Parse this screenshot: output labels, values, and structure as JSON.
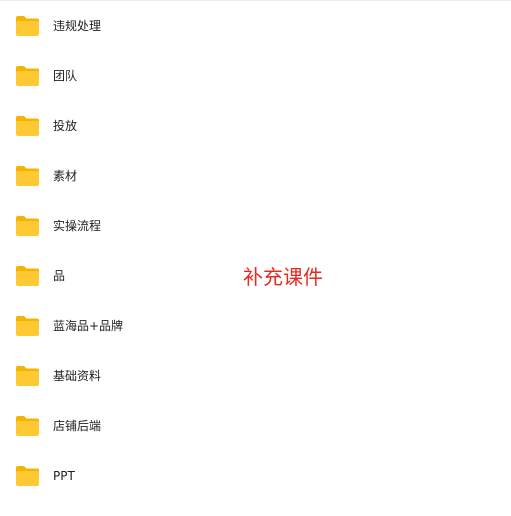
{
  "colors": {
    "folder_body": "#FFC933",
    "folder_back": "#F5B400",
    "annotation": "#E52B21"
  },
  "folders": [
    {
      "label": "违规处理",
      "icon": "folder-icon"
    },
    {
      "label": "团队",
      "icon": "folder-icon"
    },
    {
      "label": "投放",
      "icon": "folder-icon"
    },
    {
      "label": "素材",
      "icon": "folder-icon"
    },
    {
      "label": "实操流程",
      "icon": "folder-icon"
    },
    {
      "label": "品",
      "icon": "folder-icon"
    },
    {
      "label": "蓝海品+品牌",
      "icon": "folder-icon"
    },
    {
      "label": "基础资料",
      "icon": "folder-icon"
    },
    {
      "label": "店铺后端",
      "icon": "folder-icon"
    },
    {
      "label": "PPT",
      "icon": "folder-icon"
    }
  ],
  "annotation": {
    "text": "补充课件"
  }
}
